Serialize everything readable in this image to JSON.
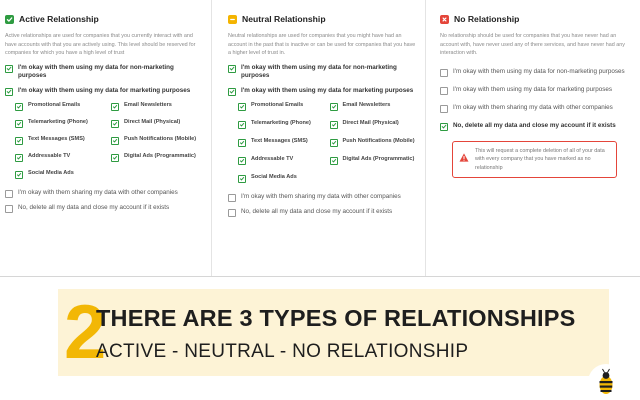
{
  "columns": {
    "active": {
      "title": "Active Relationship",
      "icon": "check-icon",
      "color": "#2e9b41",
      "description": "Active relationships are used for companies that you currently interact with and have accounts with that you are actively using. This level should be reserved for companies for which you have a high level of trust",
      "option_marketing": "I'm okay with them using my data for non-marketing purposes",
      "option_marketing2": "I'm okay with them using my data for marketing purposes",
      "sub_options": [
        "Promotional Emails",
        "Email Newsletters",
        "Telemarketing (Phone)",
        "Direct Mail (Physical)",
        "Text Messages (SMS)",
        "Push Notifications (Mobile)",
        "Addressable TV",
        "Digital Ads (Programmatic)",
        "Social Media Ads"
      ],
      "option_share": "I'm okay with them sharing my data with other companies",
      "option_delete": "No, delete all my data and close my account if it exists"
    },
    "neutral": {
      "title": "Neutral Relationship",
      "icon": "minus-icon",
      "color": "#f4b400",
      "description": "Neutral relationships are used for companies that you might have had an account in the past that is inactive or can be used for companies that you have a higher level of trust in.",
      "option_marketing": "I'm okay with them using my data for non-marketing purposes",
      "option_marketing2": "I'm okay with them using my data for marketing purposes",
      "sub_options": [
        "Promotional Emails",
        "Email Newsletters",
        "Telemarketing (Phone)",
        "Direct Mail (Physical)",
        "Text Messages (SMS)",
        "Push Notifications (Mobile)",
        "Addressable TV",
        "Digital Ads (Programmatic)",
        "Social Media Ads"
      ],
      "option_share": "I'm okay with them sharing my data with other companies",
      "option_delete": "No, delete all my data and close my account if it exists"
    },
    "none": {
      "title": "No Relationship",
      "icon": "x-icon",
      "color": "#e4453a",
      "description": "No relationship should be used for companies that you have never had an account with, have never used any of there services, and have never had any interaction with.",
      "option_marketing": "I'm okay with them using my data for non-marketing purposes",
      "option_marketing2": "I'm okay with them using my data for marketing purposes",
      "option_share": "I'm okay with them sharing my data with other companies",
      "option_delete": "No, delete all my data and close my account if it exists",
      "warning": "This will request a complete deletion of all of your data with every company that you have marked as no relationship"
    }
  },
  "banner": {
    "number": "2",
    "title": "THERE ARE 3 TYPES OF RELATIONSHIPS",
    "subtitle": "ACTIVE - NEUTRAL - NO RELATIONSHIP",
    "background": "#fdf3d6",
    "accent": "#f2b705"
  },
  "logo": {
    "icon": "bee-icon"
  }
}
